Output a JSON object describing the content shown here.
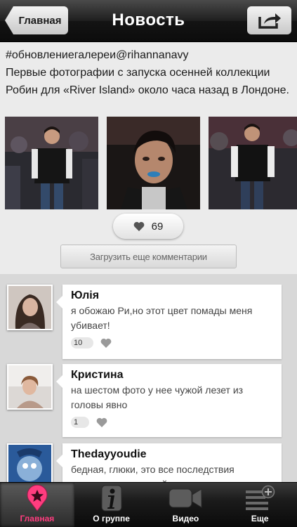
{
  "header": {
    "back_label": "Главная",
    "title": "Новость"
  },
  "post": {
    "hashtag_line": "#обновлениегалереи@rihannanavy",
    "text": "Первые фотографии с запуска осенней коллекции Робин для «River Island» около часа назад в Лондоне.",
    "likes": "69",
    "load_more_label": "Загрузить еще комментарии"
  },
  "comments": [
    {
      "name": "Юлія",
      "text": "я обожаю Ри,но этот цвет помады меня убивает!",
      "likes": "10"
    },
    {
      "name": "Кристина",
      "text": "на шестом фото у нее чужой лезет из головы явно",
      "likes": "1"
    },
    {
      "name": "Thedayyoudie",
      "text": "бедная, глюки, это все последствия просмотра клипа сайрус :с",
      "likes": ""
    }
  ],
  "tabbar": {
    "items": [
      {
        "label": "Главная",
        "icon": "star-pin-icon",
        "active": true
      },
      {
        "label": "О группе",
        "icon": "info-icon",
        "active": false
      },
      {
        "label": "Видео",
        "icon": "video-camera-icon",
        "active": false
      },
      {
        "label": "Еще",
        "icon": "more-list-icon",
        "active": false
      }
    ]
  },
  "colors": {
    "accent": "#ff3d7f",
    "header_dark": "#141414"
  }
}
